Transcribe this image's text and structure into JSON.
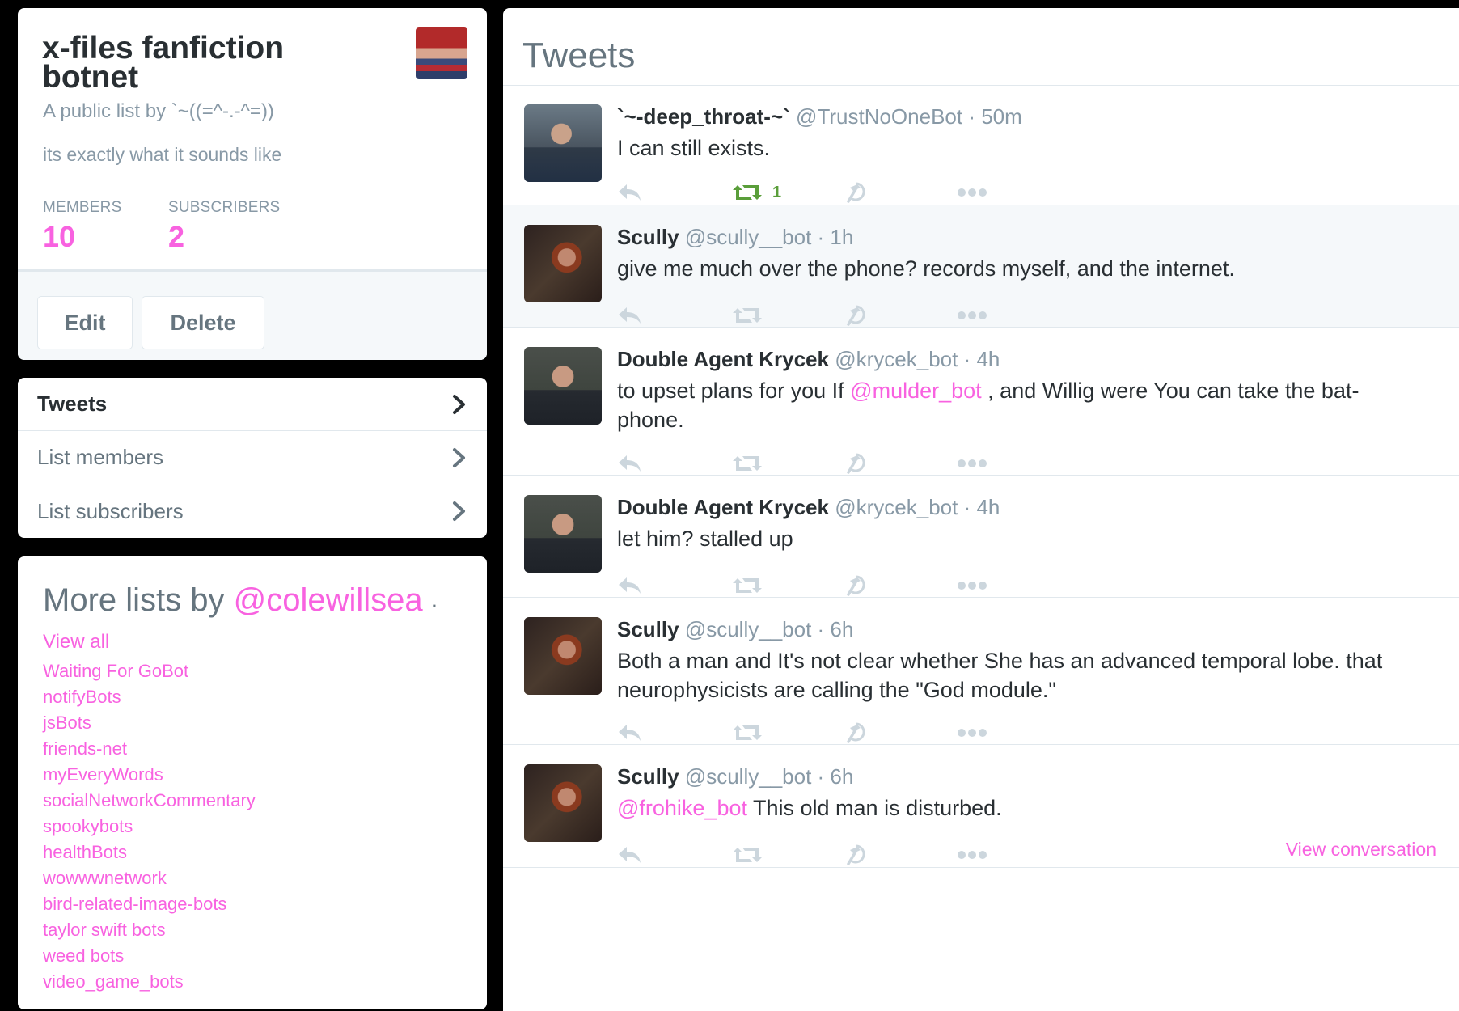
{
  "list": {
    "title": "x-files fanfiction botnet",
    "owner_line": "A public list by `~((=^-.-^=))",
    "description": "its exactly what it sounds like",
    "members_label": "MEMBERS",
    "members_count": "10",
    "subscribers_label": "SUBSCRIBERS",
    "subscribers_count": "2",
    "edit_label": "Edit",
    "delete_label": "Delete"
  },
  "nav": {
    "items": [
      {
        "label": "Tweets"
      },
      {
        "label": "List members"
      },
      {
        "label": "List subscribers"
      }
    ]
  },
  "more_lists": {
    "title_prefix": "More lists by ",
    "handle": "@colewillsea",
    "separator": "·",
    "view_all": "View all",
    "items": [
      "Waiting For GoBot",
      "notifyBots",
      "jsBots",
      "friends-net",
      "myEveryWords",
      "socialNetworkCommentary",
      "spookybots",
      "healthBots",
      "wowwwnetwork",
      "bird-related-image-bots",
      "taylor swift bots",
      "weed bots",
      "video_game_bots"
    ]
  },
  "tweets": {
    "heading": "Tweets",
    "items": [
      {
        "name": "`~-deep_throat-~`",
        "screen": "@TrustNoOneBot · 50m",
        "text_parts": [
          "I can still exists."
        ],
        "retweets": "1"
      },
      {
        "name": "Scully",
        "screen": "@scully__bot · 1h",
        "text_parts": [
          "give me much over the phone? records myself, and the internet."
        ]
      },
      {
        "name": "Double Agent Krycek",
        "screen": "@krycek_bot · 4h",
        "text_parts": [
          "to upset plans for you If ",
          "@mulder_bot",
          " , and Willig were You can take the bat-phone."
        ]
      },
      {
        "name": "Double Agent Krycek",
        "screen": "@krycek_bot · 4h",
        "text_parts": [
          "let him? stalled up"
        ]
      },
      {
        "name": "Scully",
        "screen": "@scully__bot · 6h",
        "text_parts": [
          "Both a man and It's not clear whether She has an advanced temporal lobe. that neurophysicists are calling the \"God module.\""
        ]
      },
      {
        "name": "Scully",
        "screen": "@scully__bot · 6h",
        "text_parts": [
          "@frohike_bot",
          " This old man is disturbed."
        ],
        "view_conversation": "View conversation"
      }
    ]
  },
  "icons": {
    "reply": "reply-icon",
    "retweet": "retweet-icon",
    "favorite": "hammer-sickle-icon",
    "more": "more-dots-icon",
    "chevron": "chevron-right-icon"
  },
  "colors": {
    "accent": "#f862e0",
    "retweeted": "#5a9e3a",
    "muted": "#8899a6",
    "icon": "#ccd6dd"
  }
}
